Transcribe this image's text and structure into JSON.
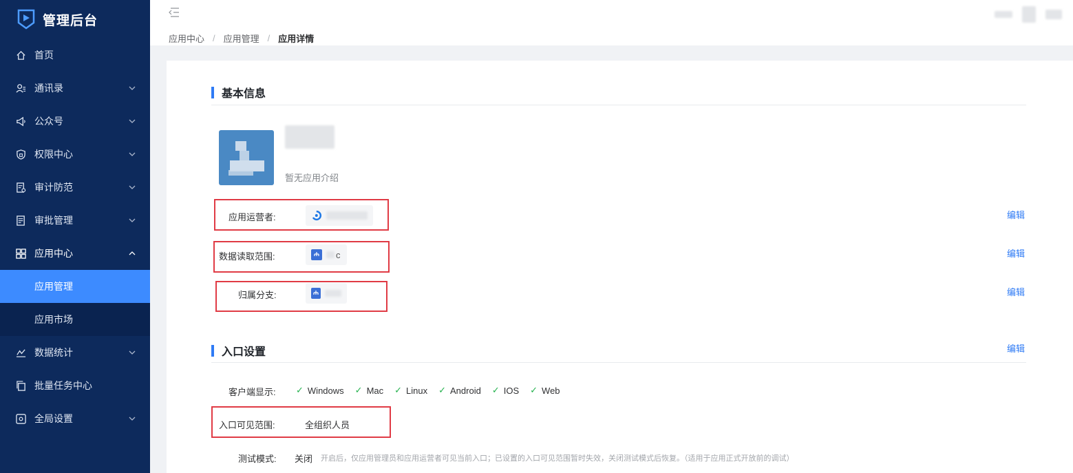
{
  "brand": {
    "title": "管理后台",
    "logo_icon": "play-logo-icon"
  },
  "sidebar": {
    "items": [
      {
        "label": "首页",
        "icon": "home-icon"
      },
      {
        "label": "通讯录",
        "icon": "contacts-icon"
      },
      {
        "label": "公众号",
        "icon": "megaphone-icon"
      },
      {
        "label": "权限中心",
        "icon": "shield-lock-icon"
      },
      {
        "label": "审计防范",
        "icon": "audit-icon"
      },
      {
        "label": "审批管理",
        "icon": "approval-icon"
      },
      {
        "label": "应用中心",
        "icon": "apps-grid-icon"
      },
      {
        "label": "数据统计",
        "icon": "chart-icon"
      },
      {
        "label": "批量任务中心",
        "icon": "copy-icon"
      },
      {
        "label": "全局设置",
        "icon": "settings-icon"
      }
    ],
    "app_submenu": [
      {
        "label": "应用管理",
        "active": true
      },
      {
        "label": "应用市场",
        "active": false
      }
    ]
  },
  "breadcrumb": {
    "items": [
      "应用中心",
      "应用管理",
      "应用详情"
    ],
    "separator": "/"
  },
  "basic_info": {
    "title": "基本信息",
    "app_desc": "暂无应用介绍",
    "operator_label": "应用运营者:",
    "data_scope_label": "数据读取范围:",
    "data_scope_value": "c",
    "branch_label": "归属分支:",
    "edit_label": "编辑"
  },
  "entry_settings": {
    "title": "入口设置",
    "edit_label": "编辑",
    "client_label": "客户端显示:",
    "platforms": [
      "Windows",
      "Mac",
      "Linux",
      "Android",
      "IOS",
      "Web"
    ],
    "visible_scope_label": "入口可见范围:",
    "visible_scope_value": "全组织人员",
    "test_mode_label": "测试模式:",
    "test_mode_value": "关闭",
    "test_mode_hint": "开启后，仅应用管理员和应用运营者可见当前入口；已设置的入口可见范围暂时失效，关闭测试模式后恢复。（适用于应用正式开放前的调试）"
  },
  "colors": {
    "sidebar_bg": "#0d2a5c",
    "active_menu": "#3d8bff",
    "accent": "#2f7bf5",
    "highlight_box": "#e03a44",
    "check": "#22b14c"
  }
}
